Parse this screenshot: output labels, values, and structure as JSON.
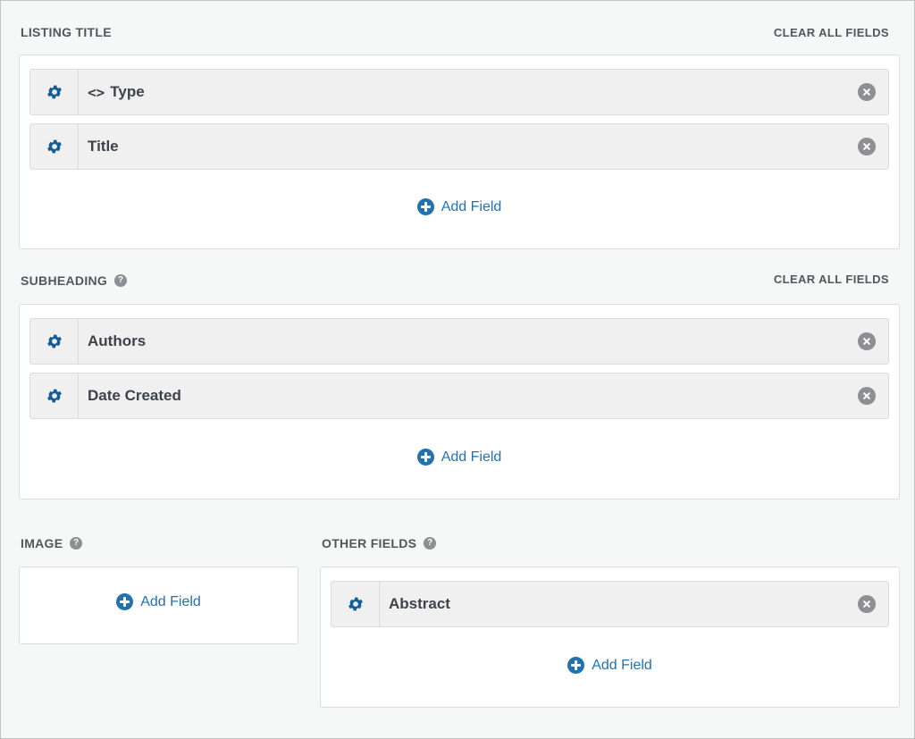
{
  "colors": {
    "accent": "#2271b1",
    "gear": "#135e96",
    "muted": "#8c8f94"
  },
  "listing_title": {
    "label": "LISTING TITLE",
    "clear_label": "CLEAR ALL FIELDS",
    "fields": [
      {
        "label": "Type",
        "icon": "code-icon"
      },
      {
        "label": "Title"
      }
    ],
    "add_label": "Add Field"
  },
  "subheading": {
    "label": "SUBHEADING",
    "help_icon": "question-icon",
    "clear_label": "CLEAR ALL FIELDS",
    "fields": [
      {
        "label": "Authors"
      },
      {
        "label": "Date Created"
      }
    ],
    "add_label": "Add Field"
  },
  "image": {
    "label": "IMAGE",
    "help_icon": "question-icon",
    "add_label": "Add Field"
  },
  "other_fields": {
    "label": "OTHER FIELDS",
    "help_icon": "question-icon",
    "fields": [
      {
        "label": "Abstract"
      }
    ],
    "add_label": "Add Field"
  }
}
